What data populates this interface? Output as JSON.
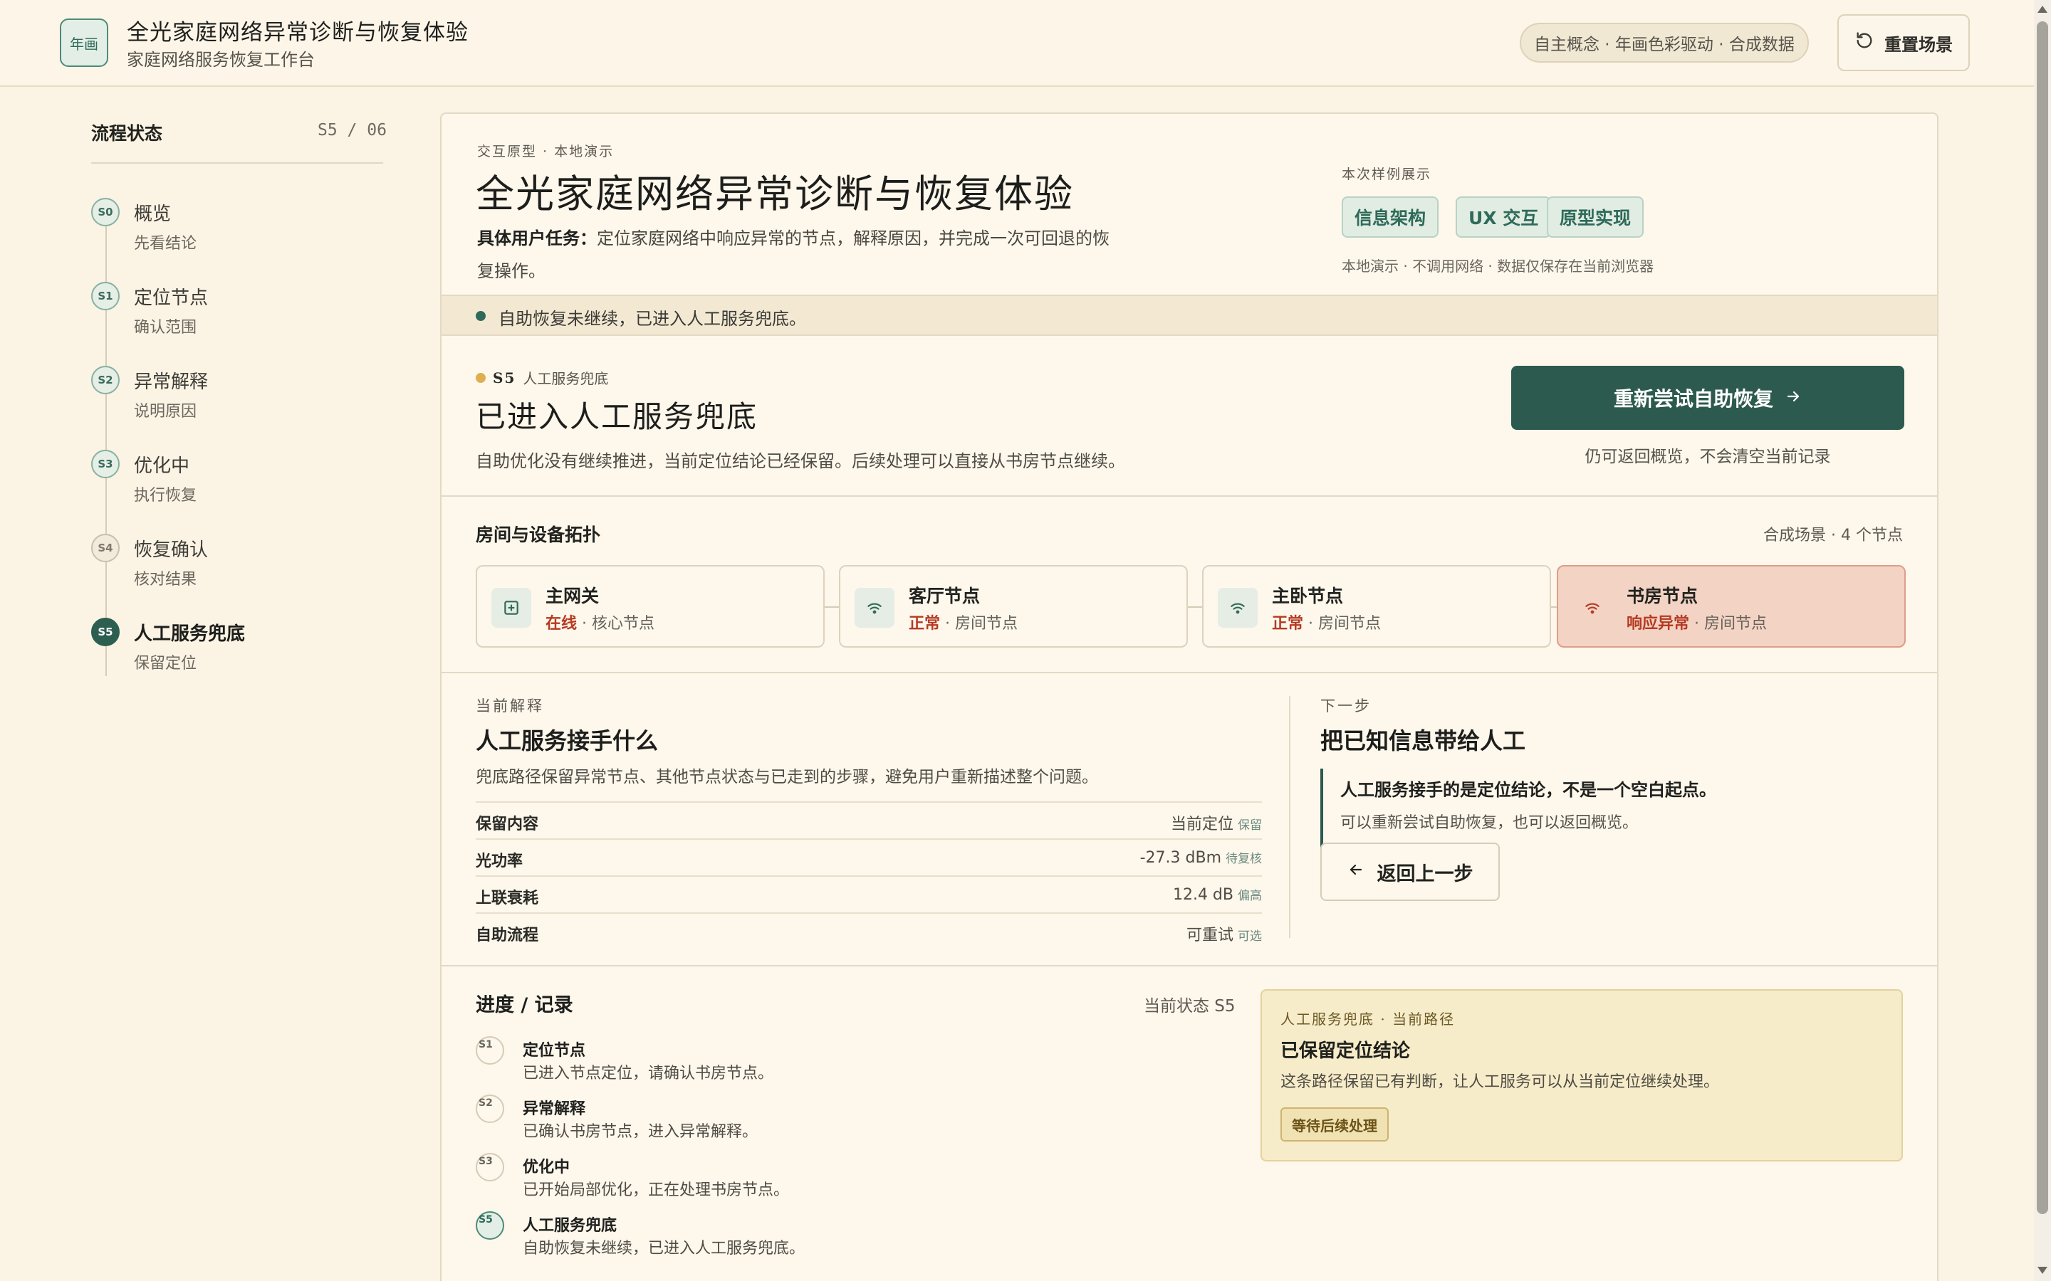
{
  "app": {
    "logo_text": "年画",
    "title": "全光家庭网络异常诊断与恢复体验",
    "subtitle": "家庭网络服务恢复工作台",
    "concept": "自主概念 · 年画色彩驱动 · 合成数据",
    "reset_label": "重置场景"
  },
  "sidebar": {
    "title": "流程状态",
    "count": "S5 / 06",
    "steps": [
      {
        "code": "S0",
        "label": "概览",
        "sub": "先看结论"
      },
      {
        "code": "S1",
        "label": "定位节点",
        "sub": "确认范围"
      },
      {
        "code": "S2",
        "label": "异常解释",
        "sub": "说明原因"
      },
      {
        "code": "S3",
        "label": "优化中",
        "sub": "执行恢复"
      },
      {
        "code": "S4",
        "label": "恢复确认",
        "sub": "核对结果"
      },
      {
        "code": "S5",
        "label": "人工服务兜底",
        "sub": "保留定位"
      }
    ]
  },
  "hero": {
    "eyebrow": "交互原型 · 本地演示",
    "title": "全光家庭网络异常诊断与恢复体验",
    "task_label": "具体用户任务：",
    "task_text": "定位家庭网络中响应异常的节点，解释原因，并完成一次可回退的恢复操作。",
    "examples_label": "本次样例展示",
    "chips": [
      "信息架构",
      "UX 交互",
      "原型实现"
    ],
    "local_note": "本地演示 · 不调用网络 · 数据仅保存在当前浏览器"
  },
  "status_strip": "自助恢复未继续，已进入人工服务兜底。",
  "stage": {
    "code": "S5",
    "tag": "人工服务兜底",
    "title": "已进入人工服务兜底",
    "desc": "自助优化没有继续推进，当前定位结论已经保留。后续处理可以直接从书房节点继续。",
    "retry_label": "重新尝试自助恢复",
    "retry_note": "仍可返回概览，不会清空当前记录"
  },
  "topology": {
    "title": "房间与设备拓扑",
    "meta": "合成场景 · 4 个节点",
    "nodes": [
      {
        "name": "主网关",
        "status": "在线",
        "role": " · 核心节点",
        "icon": "gateway-icon"
      },
      {
        "name": "客厅节点",
        "status": "正常",
        "role": " · 房间节点",
        "icon": "wifi-icon"
      },
      {
        "name": "主卧节点",
        "status": "正常",
        "role": " · 房间节点",
        "icon": "wifi-icon"
      },
      {
        "name": "书房节点",
        "status": "响应异常",
        "role": " · 房间节点",
        "icon": "wifi-icon"
      }
    ]
  },
  "explanation": {
    "eyebrow": "当前解释",
    "title": "人工服务接手什么",
    "desc": "兜底路径保留异常节点、其他节点状态与已走到的步骤，避免用户重新描述整个问题。",
    "rows": [
      {
        "k": "保留内容",
        "v": "当前定位",
        "tag": "保留"
      },
      {
        "k": "光功率",
        "v": "-27.3 dBm",
        "tag": "待复核"
      },
      {
        "k": "上联衰耗",
        "v": "12.4 dB",
        "tag": "偏高"
      },
      {
        "k": "自助流程",
        "v": "可重试",
        "tag": "可选"
      }
    ]
  },
  "next": {
    "eyebrow": "下一步",
    "title": "把已知信息带给人工",
    "quote1": "人工服务接手的是定位结论，不是一个空白起点。",
    "quote2": "可以重新尝试自助恢复，也可以返回概览。",
    "back_label": "返回上一步"
  },
  "progress": {
    "title": "进度 / 记录",
    "state": "当前状态 S5",
    "logs": [
      {
        "code": "S1",
        "title": "定位节点",
        "desc": "已进入节点定位，请确认书房节点。"
      },
      {
        "code": "S2",
        "title": "异常解释",
        "desc": "已确认书房节点，进入异常解释。"
      },
      {
        "code": "S3",
        "title": "优化中",
        "desc": "已开始局部优化，正在处理书房节点。"
      },
      {
        "code": "S5",
        "title": "人工服务兜底",
        "desc": "自助恢复未继续，已进入人工服务兜底。"
      }
    ]
  },
  "route": {
    "eyebrow": "人工服务兜底 · 当前路径",
    "title": "已保留定位结论",
    "desc": "这条路径保留已有判断，让人工服务可以从当前定位继续处理。",
    "badge": "等待后续处理"
  },
  "colors": {
    "accent": "#2d5a4e",
    "background": "#fbf3e4",
    "alert": "#b63a22",
    "warning_dot": "#dcb050"
  }
}
